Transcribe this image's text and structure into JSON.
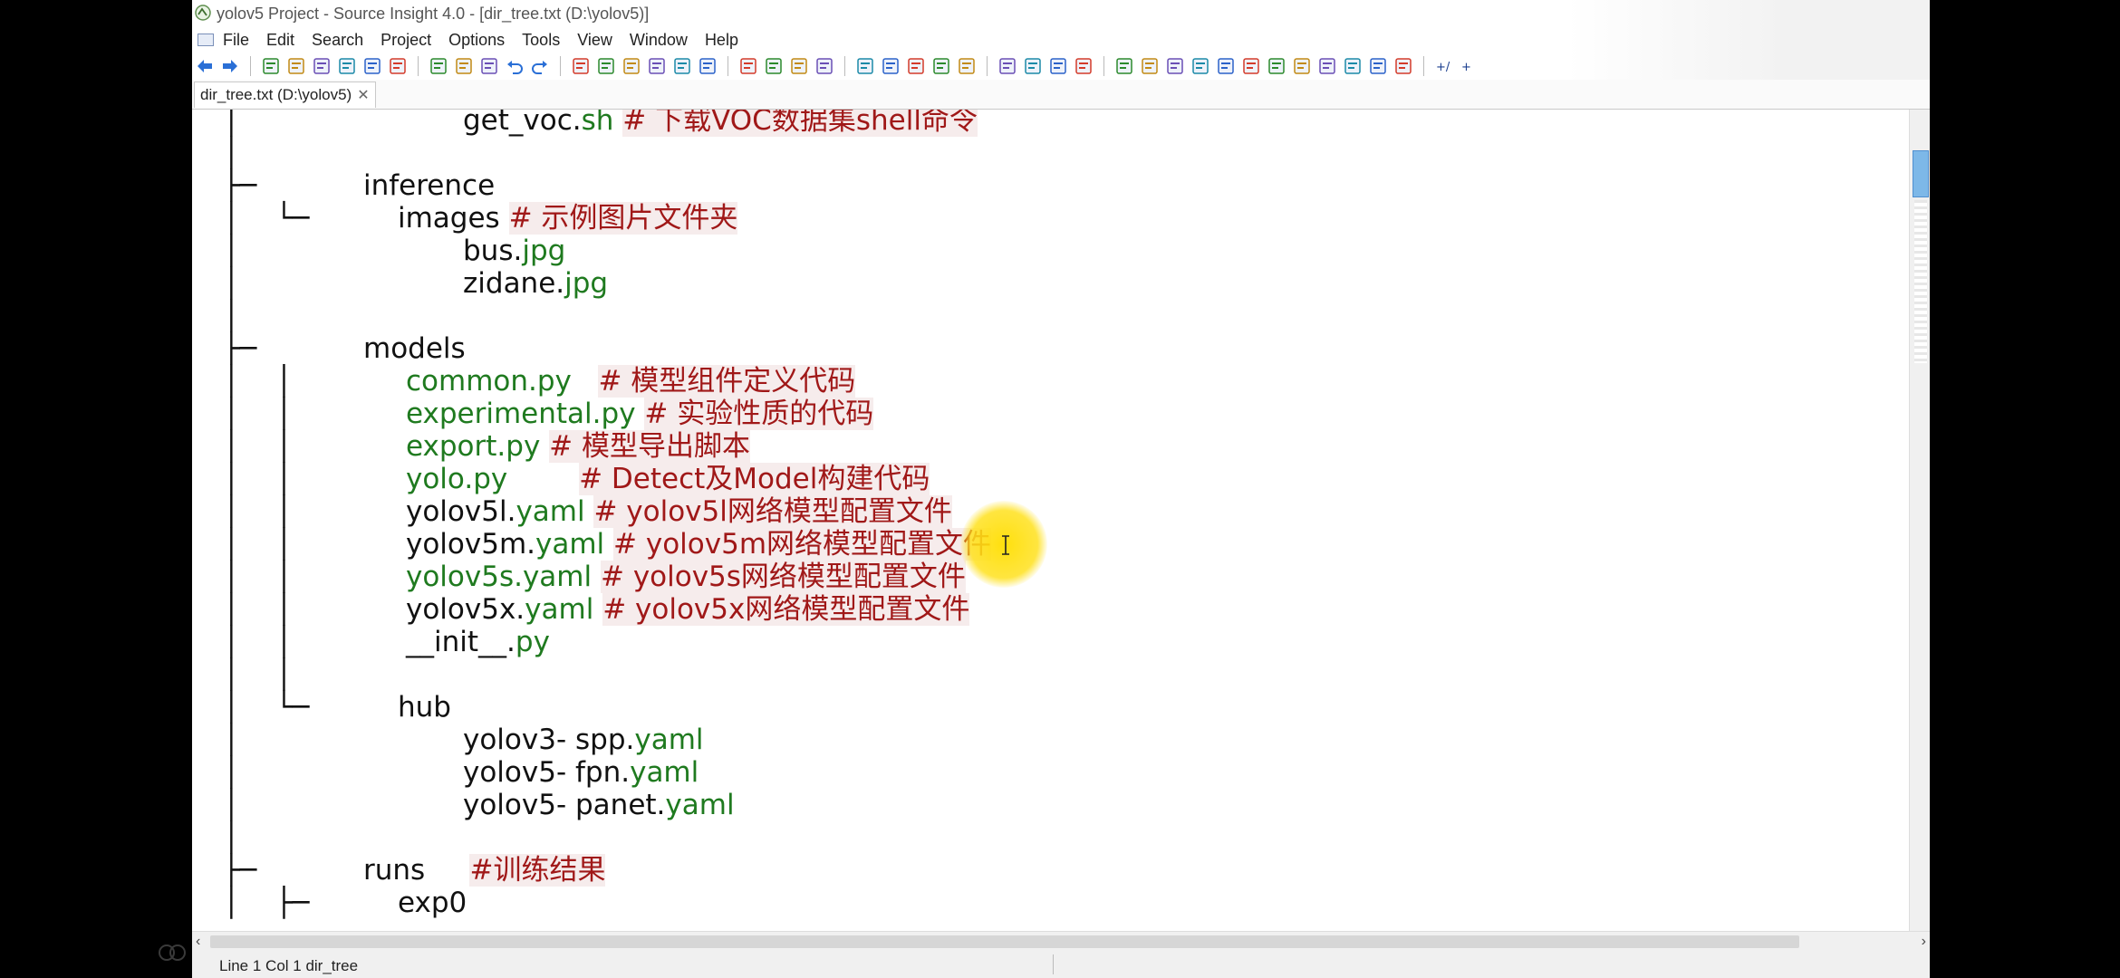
{
  "window": {
    "title": "yolov5 Project - Source Insight 4.0 - [dir_tree.txt (D:\\yolov5)]"
  },
  "menu": [
    "File",
    "Edit",
    "Search",
    "Project",
    "Options",
    "Tools",
    "View",
    "Window",
    "Help"
  ],
  "toolbar": {
    "icons": [
      "back-arrow-icon",
      "forward-arrow-icon",
      "sep",
      "new-file-icon",
      "open-folder-icon",
      "save-icon",
      "save-all-icon",
      "save-as-icon",
      "print-icon",
      "sep",
      "cut-icon",
      "copy-icon",
      "paste-icon",
      "undo-icon",
      "redo-icon",
      "sep",
      "search-files-icon",
      "jump-icon",
      "lookup-icon",
      "find-icon",
      "replace-icon",
      "browse-icon",
      "sep",
      "bookmark-icon",
      "bookmark-next-icon",
      "bookmark-prev-icon",
      "bookmark-list-icon",
      "sep",
      "symbol-window-icon",
      "relation-window-icon",
      "context-window-icon",
      "project-window-icon",
      "sync-icon",
      "sep",
      "layout-1-icon",
      "layout-2-icon",
      "layout-3-icon",
      "layout-4-icon",
      "sep",
      "panel-1-icon",
      "panel-2-icon",
      "panel-3-icon",
      "panel-4-icon",
      "panel-5-icon",
      "panel-6-icon",
      "panel-7-icon",
      "panel-8-icon",
      "panel-9-icon",
      "panel-10-icon",
      "panel-11-icon",
      "panel-12-icon",
      "sep",
      "zoom-out-icon",
      "zoom-in-icon"
    ]
  },
  "tab": {
    "label": "dir_tree.txt (D:\\yolov5)",
    "close": "✕"
  },
  "editor": {
    "lines": [
      {
        "tree": "│",
        "indent": 1,
        "segments": [
          {
            "t": "get_voc.",
            "s": ""
          },
          {
            "t": "sh",
            "s": "g"
          },
          {
            "t": " ",
            "s": ""
          },
          {
            "t": "# 下载VOC数据集shell命令",
            "s": "c"
          }
        ]
      },
      {
        "tree": "│",
        "indent": 0,
        "segments": []
      },
      {
        "tree": "├─",
        "indent": 0,
        "segments": [
          {
            "t": "inference",
            "s": ""
          }
        ]
      },
      {
        "tree": "│    └─",
        "indent": 0,
        "segments": [
          {
            "t": "images",
            "s": ""
          },
          {
            "t": " ",
            "s": ""
          },
          {
            "t": "# 示例图片文件夹",
            "s": "c"
          }
        ]
      },
      {
        "tree": "│",
        "indent": 1,
        "segments": [
          {
            "t": "bus.",
            "s": ""
          },
          {
            "t": "jpg",
            "s": "g"
          }
        ]
      },
      {
        "tree": "│",
        "indent": 1,
        "segments": [
          {
            "t": "zidane.",
            "s": ""
          },
          {
            "t": "jpg",
            "s": "g"
          }
        ]
      },
      {
        "tree": "│",
        "indent": 0,
        "segments": []
      },
      {
        "tree": "├─",
        "indent": 0,
        "segments": [
          {
            "t": "models",
            "s": ""
          }
        ]
      },
      {
        "tree": "│    │",
        "indent": 2,
        "segments": [
          {
            "t": "common.py",
            "s": "g"
          },
          {
            "t": "   ",
            "s": ""
          },
          {
            "t": "# 模型组件定义代码",
            "s": "c"
          }
        ]
      },
      {
        "tree": "│    │",
        "indent": 2,
        "segments": [
          {
            "t": "experimental.py",
            "s": "g"
          },
          {
            "t": " ",
            "s": ""
          },
          {
            "t": "# 实验性质的代码",
            "s": "c"
          }
        ]
      },
      {
        "tree": "│    │",
        "indent": 2,
        "segments": [
          {
            "t": "export.py",
            "s": "g"
          },
          {
            "t": " ",
            "s": ""
          },
          {
            "t": "# 模型导出脚本",
            "s": "c"
          }
        ]
      },
      {
        "tree": "│    │",
        "indent": 2,
        "segments": [
          {
            "t": "yolo.py",
            "s": "g"
          },
          {
            "t": "        ",
            "s": ""
          },
          {
            "t": "# Detect及Model构建代码",
            "s": "c"
          }
        ]
      },
      {
        "tree": "│    │",
        "indent": 2,
        "segments": [
          {
            "t": "yolov5l.",
            "s": ""
          },
          {
            "t": "yaml",
            "s": "g"
          },
          {
            "t": " ",
            "s": ""
          },
          {
            "t": "# yolov5l网络模型配置文件",
            "s": "c"
          }
        ]
      },
      {
        "tree": "│    │",
        "indent": 2,
        "segments": [
          {
            "t": "yolov5m.",
            "s": ""
          },
          {
            "t": "yaml",
            "s": "g"
          },
          {
            "t": " ",
            "s": ""
          },
          {
            "t": "# yolov5m网络模型配置文件",
            "s": "c"
          }
        ]
      },
      {
        "tree": "│    │",
        "indent": 2,
        "segments": [
          {
            "t": "yolov5s.yaml",
            "s": "g"
          },
          {
            "t": " ",
            "s": ""
          },
          {
            "t": "# yolov5s网络模型配置文件",
            "s": "c"
          }
        ]
      },
      {
        "tree": "│    │",
        "indent": 2,
        "segments": [
          {
            "t": "yolov5x.",
            "s": ""
          },
          {
            "t": "yaml",
            "s": "g"
          },
          {
            "t": " ",
            "s": ""
          },
          {
            "t": "# yolov5x网络模型配置文件",
            "s": "c"
          }
        ]
      },
      {
        "tree": "│    │",
        "indent": 2,
        "segments": [
          {
            "t": "__init__.",
            "s": ""
          },
          {
            "t": "py",
            "s": "g"
          }
        ]
      },
      {
        "tree": "│    │",
        "indent": 0,
        "segments": []
      },
      {
        "tree": "│    └─",
        "indent": 0,
        "segments": [
          {
            "t": "hub",
            "s": ""
          }
        ]
      },
      {
        "tree": "│",
        "indent": 1,
        "segments": [
          {
            "t": "yolov3- spp.",
            "s": ""
          },
          {
            "t": "yaml",
            "s": "g"
          }
        ]
      },
      {
        "tree": "│",
        "indent": 1,
        "segments": [
          {
            "t": "yolov5- fpn.",
            "s": ""
          },
          {
            "t": "yaml",
            "s": "g"
          }
        ]
      },
      {
        "tree": "│",
        "indent": 1,
        "segments": [
          {
            "t": "yolov5- panet.",
            "s": ""
          },
          {
            "t": "yaml",
            "s": "g"
          }
        ]
      },
      {
        "tree": "│",
        "indent": 0,
        "segments": []
      },
      {
        "tree": "├─",
        "indent": 0,
        "segments": [
          {
            "t": "runs",
            "s": ""
          },
          {
            "t": "     ",
            "s": ""
          },
          {
            "t": "#训练结果",
            "s": "c"
          }
        ]
      },
      {
        "tree": "│    ├─",
        "indent": 0,
        "segments": [
          {
            "t": "exp0",
            "s": ""
          }
        ]
      }
    ]
  },
  "statusbar": {
    "position": "Line 1  Col 1   dir_tree"
  },
  "scroll": {
    "left_arrow": "‹",
    "right_arrow": "›"
  },
  "colors": {
    "filename_green": "#1f7a1f",
    "comment_red": "#a01818",
    "cursor_highlight": "#ffde00"
  }
}
